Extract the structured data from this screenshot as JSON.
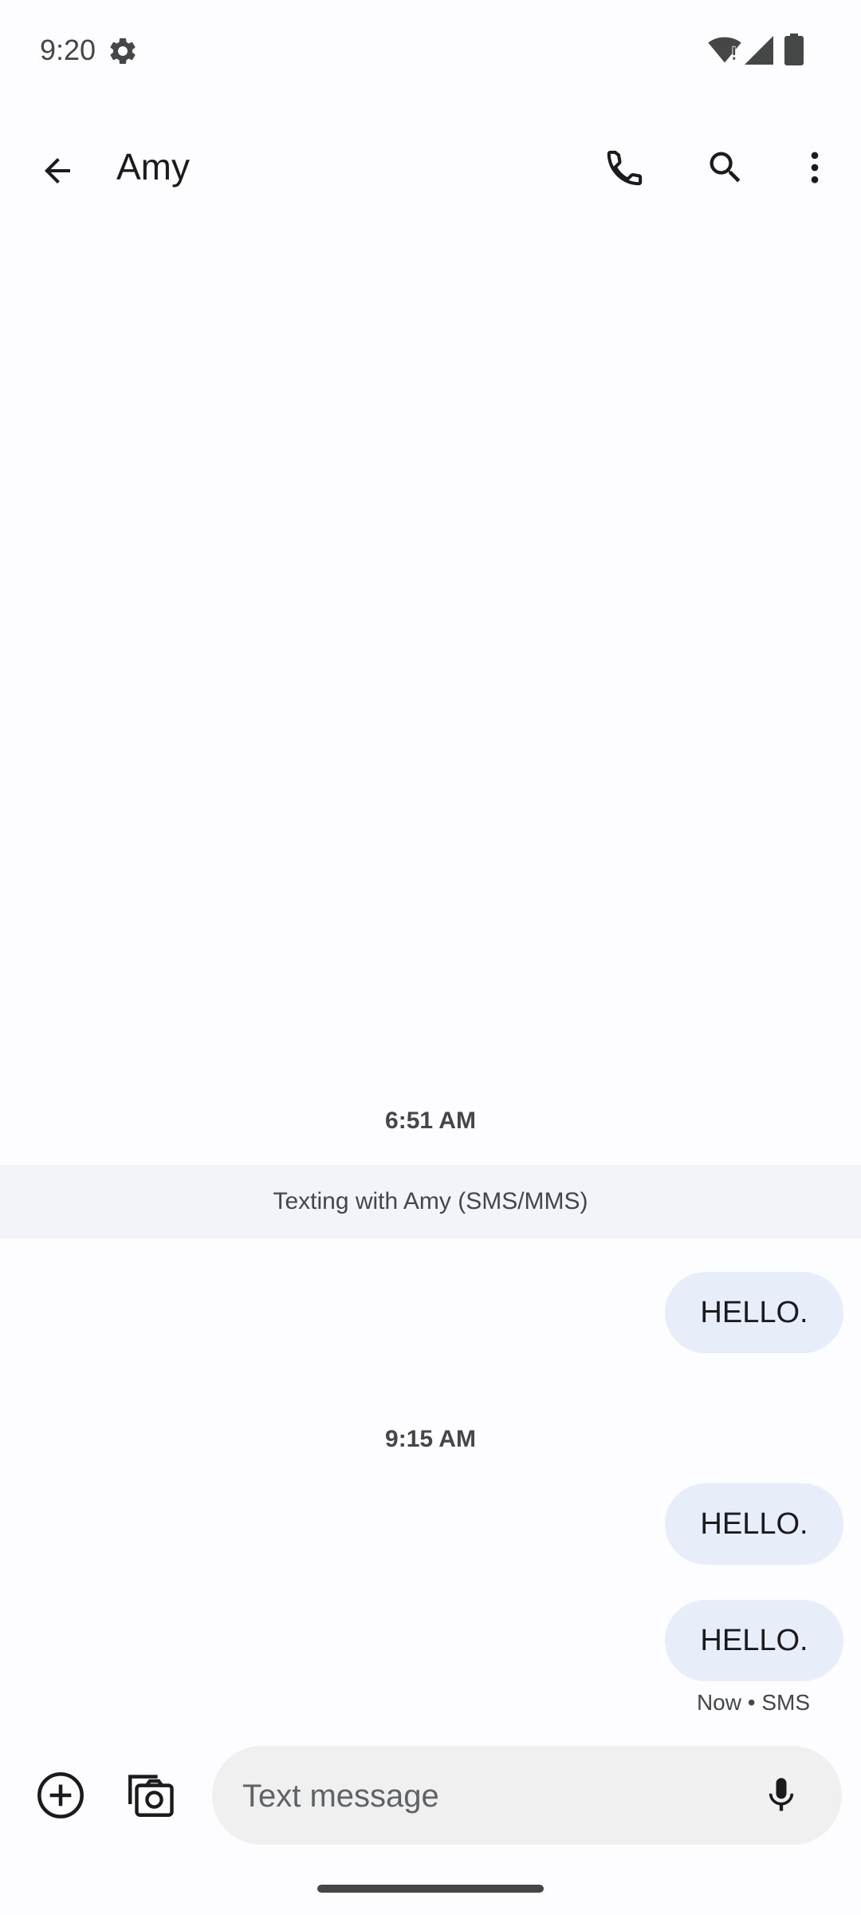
{
  "status_bar": {
    "time": "9:20",
    "icons": [
      "gear-icon",
      "wifi-icon",
      "signal-icon",
      "battery-icon"
    ]
  },
  "app_bar": {
    "title": "Amy",
    "icons": [
      "back-arrow-icon",
      "phone-icon",
      "search-icon",
      "more-vert-icon"
    ]
  },
  "conversation": {
    "groups": [
      {
        "timestamp": "6:51 AM",
        "banner": "Texting with Amy (SMS/MMS)",
        "messages": [
          "HELLO."
        ]
      },
      {
        "timestamp": "9:15 AM",
        "messages": [
          "HELLO.",
          "HELLO."
        ],
        "status": "Now • SMS"
      }
    ]
  },
  "compose": {
    "placeholder": "Text message",
    "value": "",
    "icons": [
      "add-circle-icon",
      "camera-icon",
      "mic-icon"
    ]
  },
  "colors": {
    "background": "#fdfcff",
    "bubble": "#e8edfa",
    "banner": "#f3f4f9",
    "compose_field": "#f0f0f0",
    "text_primary": "#1b1b1f",
    "text_secondary": "#444746"
  }
}
